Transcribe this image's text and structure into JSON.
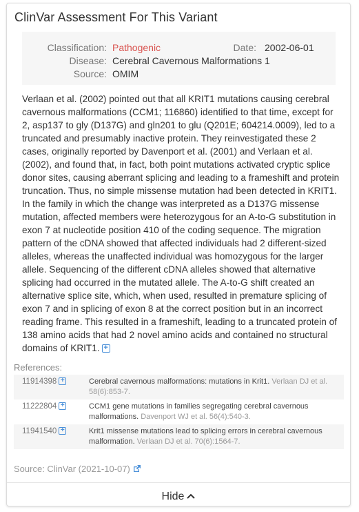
{
  "card": {
    "title": "ClinVar Assessment For This Variant"
  },
  "classification": {
    "classification_label": "Classification:",
    "classification_value": "Pathogenic",
    "date_label": "Date:",
    "date_value": "2002-06-01",
    "disease_label": "Disease:",
    "disease_value": "Cerebral Cavernous Malformations 1",
    "source_label": "Source:",
    "source_value": "OMIM",
    "pathogenic_color": "#d9534f"
  },
  "description": "Verlaan et al. (2002) pointed out that all KRIT1 mutations causing cerebral cavernous malformations (CCM1; 116860) identified to that time, except for 2, asp137 to gly (D137G) and gln201 to glu (Q201E; 604214.0009), led to a truncated and presumably inactive protein. They reinvestigated these 2 cases, originally reported by Davenport et al. (2001) and Verlaan et al. (2002), and found that, in fact, both point mutations activated cryptic splice donor sites, causing aberrant splicing and leading to a frameshift and protein truncation. Thus, no simple missense mutation had been detected in KRIT1. In the family in which the change was interpreted as a D137G missense mutation, affected members were heterozygous for an A-to-G substitution in exon 7 at nucleotide position 410 of the coding sequence. The migration pattern of the cDNA showed that affected individuals had 2 different-sized alleles, whereas the unaffected individual was homozygous for the larger allele. Sequencing of the different cDNA alleles showed that alternative splicing had occurred in the mutated allele. The A-to-G shift created an alternative splice site, which, when used, resulted in premature splicing of exon 7 and in splicing of exon 8 at the correct position but in an incorrect reading frame. This resulted in a frameshift, leading to a truncated protein of 138 amino acids that had 2 novel amino acids and contained no structural domains of KRIT1.",
  "references": {
    "label": "References:",
    "items": [
      {
        "id": "11914398",
        "title": "Cerebral cavernous malformations: mutations in Krit1.",
        "authors": "Verlaan DJ et al. 58(6):853-7."
      },
      {
        "id": "11222804",
        "title": "CCM1 gene mutations in families segregating cerebral cavernous malformations.",
        "authors": "Davenport WJ et al. 56(4):540-3."
      },
      {
        "id": "11941540",
        "title": "Krit1 missense mutations lead to splicing errors in cerebral cavernous malformation.",
        "authors": "Verlaan DJ et al. 70(6):1564-7."
      }
    ]
  },
  "source_footer": "Source: ClinVar (2021-10-07)",
  "hide_label": "Hide",
  "icons": [
    "plus-square-icon",
    "external-link-icon",
    "chevron-up-icon"
  ],
  "accent_color": "#4a90d9"
}
